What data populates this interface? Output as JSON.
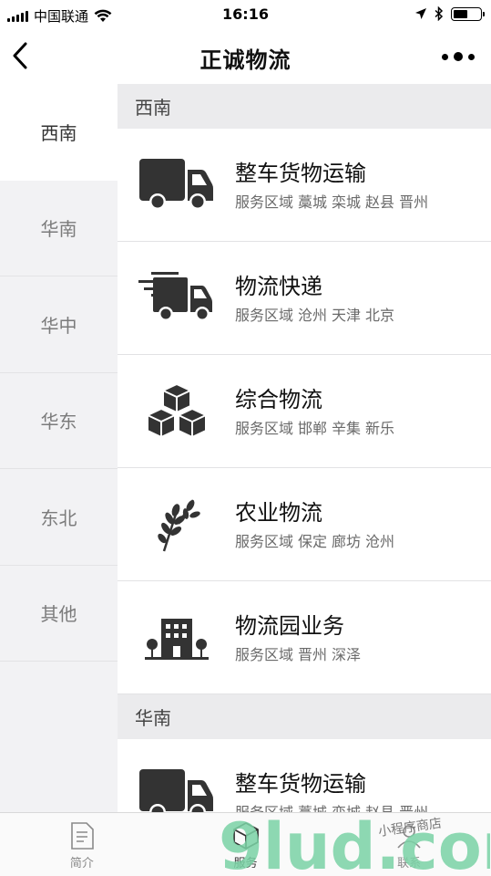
{
  "status_bar": {
    "carrier": "中国联通",
    "time": "16:16",
    "battery_level": 0.55
  },
  "nav": {
    "title": "正诚物流"
  },
  "sidebar": {
    "items": [
      {
        "label": "西南",
        "active": true
      },
      {
        "label": "华南"
      },
      {
        "label": "华中"
      },
      {
        "label": "华东"
      },
      {
        "label": "东北"
      },
      {
        "label": "其他"
      }
    ]
  },
  "sections": [
    {
      "header": "西南",
      "rows": [
        {
          "title": "整车货物运输",
          "sub_label": "服务区域",
          "areas": [
            "藁城",
            "栾城",
            "赵县",
            "晋州"
          ],
          "icon": "truck-icon"
        },
        {
          "title": "物流快递",
          "sub_label": "服务区域",
          "areas": [
            "沧州",
            "天津",
            "北京"
          ],
          "icon": "express-truck-icon"
        },
        {
          "title": "综合物流",
          "sub_label": "服务区域",
          "areas": [
            "邯郸",
            "辛集",
            "新乐"
          ],
          "icon": "boxes-icon"
        },
        {
          "title": "农业物流",
          "sub_label": "服务区域",
          "areas": [
            "保定",
            "廊坊",
            "沧州"
          ],
          "icon": "wheat-icon"
        },
        {
          "title": "物流园业务",
          "sub_label": "服务区域",
          "areas": [
            "晋州",
            "深泽"
          ],
          "icon": "building-icon"
        }
      ]
    },
    {
      "header": "华南",
      "rows": [
        {
          "title": "整车货物运输",
          "sub_label": "服务区域",
          "areas": [
            "藁城",
            "栾城",
            "赵县",
            "晋州"
          ],
          "icon": "truck-icon"
        }
      ]
    }
  ],
  "tabbar": {
    "tabs": [
      {
        "label": "简介",
        "icon": "document-icon"
      },
      {
        "label": "服务",
        "icon": "cube-icon",
        "active": true
      },
      {
        "label": "联系",
        "icon": "contact-icon"
      }
    ]
  },
  "watermark": {
    "text": "9lud.com",
    "shop": "小程序商店"
  }
}
